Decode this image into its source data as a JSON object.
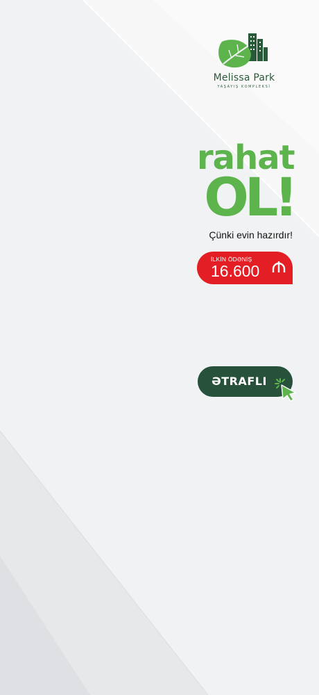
{
  "brand": {
    "name": "Melissa Park",
    "subtitle": "YAŞAYIŞ KOMPLEKSİ",
    "logo_icon": "leaf-building-logo"
  },
  "headline": {
    "line1": "rahat",
    "line2": "OL!",
    "tagline": "Çünki evin hazırdır!"
  },
  "price_badge": {
    "label": "İLKİN ÖDƏNİŞ",
    "value": "16.600",
    "currency_icon": "manat-icon"
  },
  "cta": {
    "label": "ƏTRAFLI",
    "cursor_icon": "click-cursor-icon"
  },
  "colors": {
    "green": "#5db34c",
    "dark_green": "#27513a",
    "red": "#e31e24",
    "background": "#f1f2f4"
  }
}
